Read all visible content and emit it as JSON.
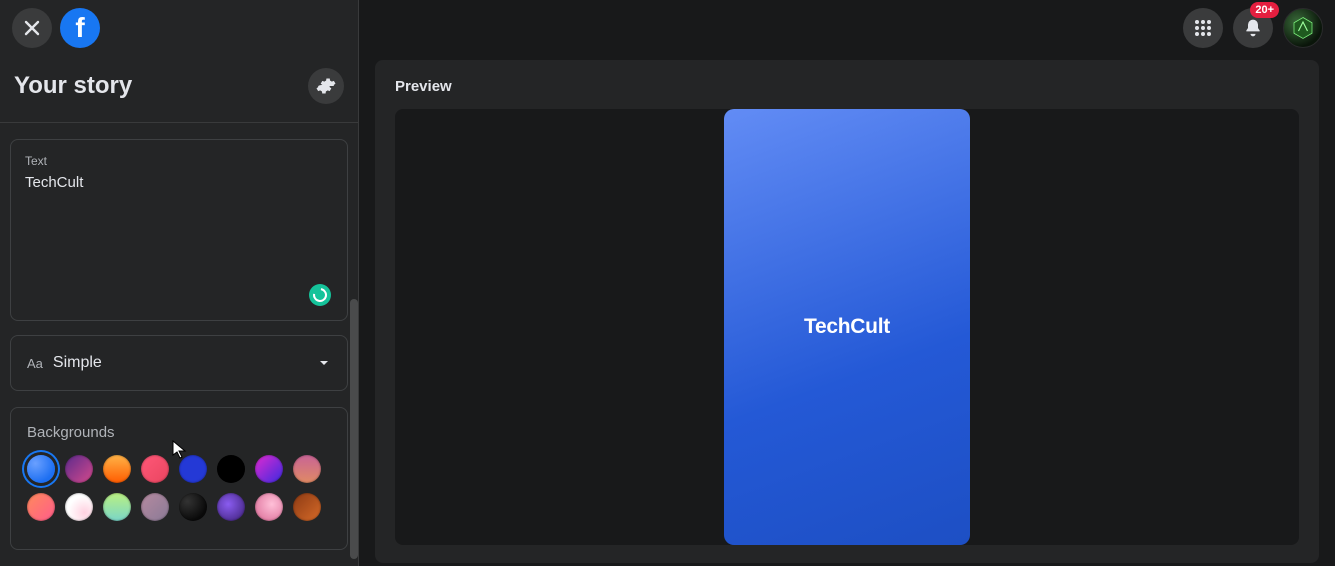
{
  "topbar": {
    "notifications_badge": "20+"
  },
  "sidebar": {
    "title": "Your story",
    "text_panel": {
      "label": "Text",
      "value": "TechCult"
    },
    "font_select": {
      "aa": "Aa",
      "name": "Simple"
    },
    "backgrounds": {
      "label": "Backgrounds",
      "row1": [
        {
          "name": "blue-gradient",
          "css": "radial-gradient(circle at 30% 30%, #6aa0ff, #1d6ff2 70%)",
          "selected": true
        },
        {
          "name": "purple-pink",
          "css": "linear-gradient(135deg, #5b2a8c, #d54a8c)",
          "selected": false
        },
        {
          "name": "orange-yellow",
          "css": "linear-gradient(180deg, #ffb347 0%, #ff5c00 100%)",
          "selected": false
        },
        {
          "name": "coral",
          "css": "linear-gradient(135deg, #ff5878, #e94560)",
          "selected": false
        },
        {
          "name": "royal-blue",
          "css": "#2439d6",
          "selected": false
        },
        {
          "name": "black",
          "css": "#000000",
          "selected": false
        },
        {
          "name": "magenta-blue",
          "css": "linear-gradient(135deg, #e02ad0, #3a2ae0)",
          "selected": false
        },
        {
          "name": "sunset-pink",
          "css": "linear-gradient(180deg, #c86496, #e08a64)",
          "selected": false
        }
      ],
      "row2": [
        {
          "name": "peach-pink",
          "css": "linear-gradient(135deg, #ff8a5c, #ff5c8a)",
          "selected": false
        },
        {
          "name": "white-rose",
          "css": "radial-gradient(circle at 70% 70%, #ffd1e0, #ffffff 60%)",
          "selected": false
        },
        {
          "name": "lime-sky",
          "css": "linear-gradient(180deg, #baf081, #7ad6c8)",
          "selected": false
        },
        {
          "name": "mauve",
          "css": "linear-gradient(135deg, #b58aa0, #8a7a96)",
          "selected": false
        },
        {
          "name": "black-stars",
          "css": "radial-gradient(circle at 30% 30%, #333, #0a0a0a 70%)",
          "selected": false
        },
        {
          "name": "violet-blur",
          "css": "radial-gradient(circle at 40% 40%, #8a5cf0, #4a2a8c 80%)",
          "selected": false
        },
        {
          "name": "pink-petals",
          "css": "radial-gradient(circle at 60% 40%, #ffc0d8, #e078a0 80%)",
          "selected": false
        },
        {
          "name": "burnt-orange",
          "css": "linear-gradient(135deg, #8c3a14, #d66a28)",
          "selected": false
        }
      ]
    }
  },
  "preview": {
    "label": "Preview",
    "story_text": "TechCult"
  }
}
